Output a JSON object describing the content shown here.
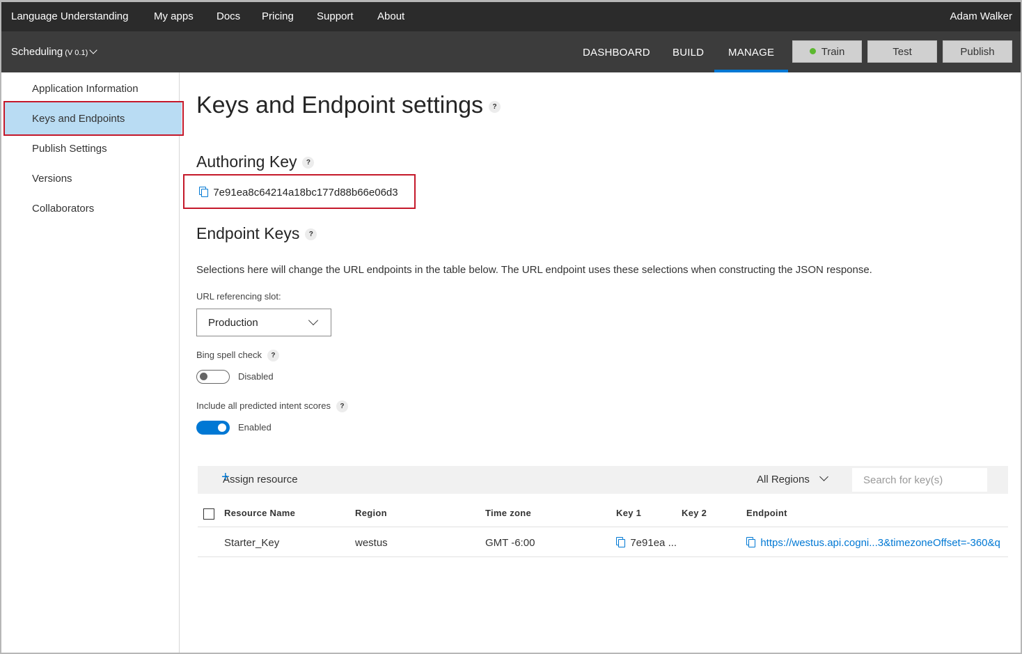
{
  "topnav": {
    "brand": "Language Understanding",
    "links": [
      "My apps",
      "Docs",
      "Pricing",
      "Support",
      "About"
    ],
    "user": "Adam Walker"
  },
  "appbar": {
    "app_name": "Scheduling",
    "version": "(V 0.1)",
    "tabs": [
      "DASHBOARD",
      "BUILD",
      "MANAGE"
    ],
    "active_tab": "MANAGE",
    "buttons": {
      "train": "Train",
      "test": "Test",
      "publish": "Publish"
    }
  },
  "sidebar": {
    "items": [
      {
        "label": "Application Information"
      },
      {
        "label": "Keys and Endpoints",
        "active": true
      },
      {
        "label": "Publish Settings"
      },
      {
        "label": "Versions"
      },
      {
        "label": "Collaborators"
      }
    ]
  },
  "main": {
    "title": "Keys and Endpoint settings",
    "help_glyph": "?",
    "authoring": {
      "heading": "Authoring Key",
      "key": "7e91ea8c64214a18bc177d88b66e06d3"
    },
    "endpoint": {
      "heading": "Endpoint Keys",
      "description": "Selections here will change the URL endpoints in the table below. The URL endpoint uses these selections when constructing the JSON response.",
      "slot_label": "URL referencing slot:",
      "slot_value": "Production",
      "bing_label": "Bing spell check",
      "bing_state": "Disabled",
      "intent_label": "Include all predicted intent scores",
      "intent_state": "Enabled"
    },
    "resources": {
      "assign_label": "Assign resource",
      "regions_label": "All Regions",
      "search_placeholder": "Search for key(s)",
      "columns": [
        "Resource Name",
        "Region",
        "Time zone",
        "Key 1",
        "Key 2",
        "Endpoint"
      ],
      "rows": [
        {
          "name": "Starter_Key",
          "region": "westus",
          "timezone": "GMT -6:00",
          "key1": "7e91ea ...",
          "key2": "",
          "endpoint": "https://westus.api.cogni...3&timezoneOffset=-360&q"
        }
      ]
    }
  },
  "colors": {
    "accent": "#0078d4",
    "highlight": "#c4182a",
    "active_item": "#b9dcf3",
    "train_dot": "#5cb82f"
  }
}
